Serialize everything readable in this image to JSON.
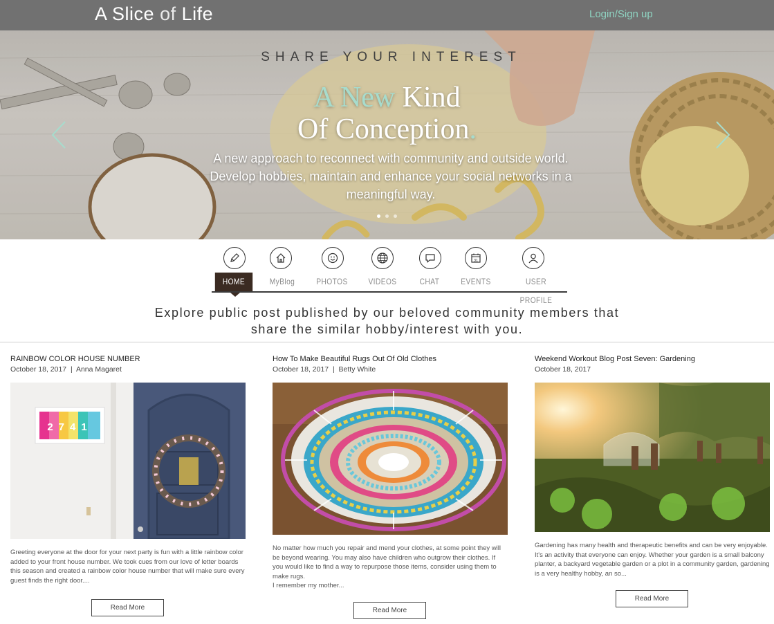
{
  "header": {
    "brand_a": "A Slice",
    "brand_of": "of",
    "brand_b": "Life",
    "login": "Login/Sign up"
  },
  "hero": {
    "kicker": "SHARE YOUR INTEREST",
    "headline_accent": "A New",
    "headline_rest": "Kind",
    "headline_line2": "Of Conception",
    "headline_dot": ".",
    "subtext": "A new approach to reconnect with community and outside world. Develop hobbies, maintain and enhance your social networks in a meaningful way.",
    "slide_count": 3,
    "active_slide": 1
  },
  "nav": {
    "items": [
      {
        "label": "HOME",
        "icon": "pencil-icon",
        "active": true
      },
      {
        "label": "MyBlog",
        "icon": "house-icon",
        "active": false
      },
      {
        "label": "PHOTOS",
        "icon": "smiley-icon",
        "active": false
      },
      {
        "label": "VIDEOS",
        "icon": "globe-icon",
        "active": false
      },
      {
        "label": "CHAT",
        "icon": "speech-bubble-icon",
        "active": false
      },
      {
        "label": "EVENTS",
        "icon": "calendar-icon",
        "active": false
      },
      {
        "label": "USER PROFILE",
        "icon": "user-icon",
        "active": false
      }
    ],
    "calendar_day": "31"
  },
  "intro": {
    "line1": "Explore public post published by our beloved community members that",
    "line2": "share the similar hobby/interest with you."
  },
  "posts": [
    {
      "title": "RAINBOW COLOR HOUSE NUMBER",
      "date": "October 18, 2017",
      "author": "Anna Magaret",
      "house_number": "2741",
      "excerpt": "Greeting everyone at the door for your next party is fun with a little rainbow color added to your front house number. We took cues from our love of letter boards this season and created a rainbow color house number that will make sure every guest finds the right door....",
      "read_more": "Read More"
    },
    {
      "title": "How To Make Beautiful Rugs Out Of Old Clothes",
      "date": "October 18, 2017",
      "author": "Betty White",
      "excerpt": "No matter how much you repair and mend your clothes, at some point they will be beyond wearing.  You may also have children who outgrow their clothes.  If you would like to find a way to repurpose those items, consider using them to make rugs.",
      "excerpt_2": "I remember my mother...",
      "read_more": "Read More"
    },
    {
      "title": "Weekend Workout Blog Post Seven: Gardening",
      "date": "October 18, 2017",
      "author": "",
      "excerpt": "Gardening has many health and therapeutic benefits and can be very enjoyable. It's an activity that everyone can enjoy. Whether your garden is a small balcony planter, a backyard vegetable garden or a plot in a community garden, gardening is a very healthy hobby, an so...",
      "read_more": "Read More"
    }
  ],
  "colors": {
    "topbar": "#717171",
    "accent": "#a7dccd",
    "login": "#8fd4c2",
    "nav_active": "#3b2b22"
  }
}
